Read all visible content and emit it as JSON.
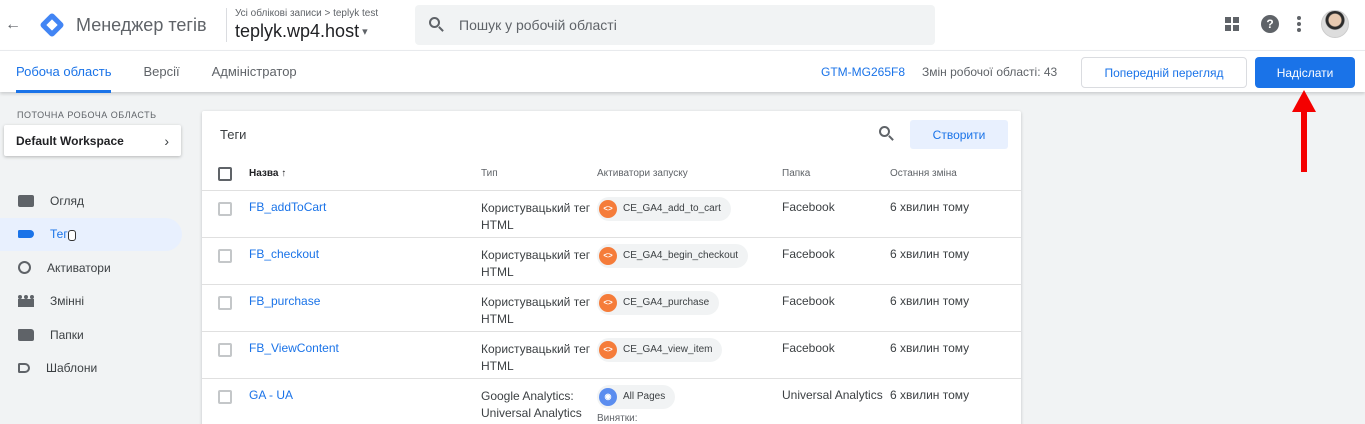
{
  "appbar": {
    "back_icon": "←",
    "app_title": "Менеджер тегів",
    "breadcrumb": "Усі облікові записи > teplyk test",
    "container_name": "teplyk.wp4.host",
    "caret": "▾",
    "search_placeholder": "Пошук у робочій області"
  },
  "subnav": {
    "tabs": [
      "Робоча область",
      "Версії",
      "Адміністратор"
    ],
    "gtm_id": "GTM-MG265F8",
    "changes": "Змін робочої області: 43",
    "preview_label": "Попередній перегляд",
    "submit_label": "Надіслати"
  },
  "sidebar": {
    "workspace_label": "ПОТОЧНА РОБОЧА ОБЛАСТЬ",
    "workspace_name": "Default Workspace",
    "chevron": "›",
    "items": [
      {
        "label": "Огляд",
        "icon": "overview-icon"
      },
      {
        "label": "Теги",
        "icon": "tag-icon"
      },
      {
        "label": "Активатори",
        "icon": "trigger-icon"
      },
      {
        "label": "Змінні",
        "icon": "variables-icon"
      },
      {
        "label": "Папки",
        "icon": "folder-icon"
      },
      {
        "label": "Шаблони",
        "icon": "template-icon"
      }
    ]
  },
  "tags_card": {
    "title": "Теги",
    "create_label": "Створити",
    "columns": {
      "name": "Назва ↑",
      "type": "Тип",
      "triggers": "Активатори запуску",
      "folder": "Папка",
      "last_changed": "Остання зміна"
    },
    "rows": [
      {
        "name": "FB_addToCart",
        "type_line1": "Користувацький тег",
        "type_line2": "HTML",
        "trigger": "CE_GA4_add_to_cart",
        "trigger_icon": "<>",
        "folder": "Facebook",
        "last_changed": "6 хвилин тому"
      },
      {
        "name": "FB_checkout",
        "type_line1": "Користувацький тег",
        "type_line2": "HTML",
        "trigger": "CE_GA4_begin_checkout",
        "trigger_icon": "<>",
        "folder": "Facebook",
        "last_changed": "6 хвилин тому"
      },
      {
        "name": "FB_purchase",
        "type_line1": "Користувацький тег",
        "type_line2": "HTML",
        "trigger": "CE_GA4_purchase",
        "trigger_icon": "<>",
        "folder": "Facebook",
        "last_changed": "6 хвилин тому"
      },
      {
        "name": "FB_ViewContent",
        "type_line1": "Користувацький тег",
        "type_line2": "HTML",
        "trigger": "CE_GA4_view_item",
        "trigger_icon": "<>",
        "folder": "Facebook",
        "last_changed": "6 хвилин тому"
      },
      {
        "name": "GA - UA",
        "type_line1": "Google Analytics:",
        "type_line2": "Universal Analytics",
        "trigger": "All Pages",
        "trigger_icon": "◉",
        "exceptions": "Винятки:",
        "folder": "Universal Analytics",
        "last_changed": "6 хвилин тому"
      }
    ]
  },
  "colors": {
    "accent": "#1a73e8",
    "annotation_arrow": "#f40000",
    "custom_event_trigger": "#f57c3a",
    "pageview_trigger": "#5b8def"
  }
}
